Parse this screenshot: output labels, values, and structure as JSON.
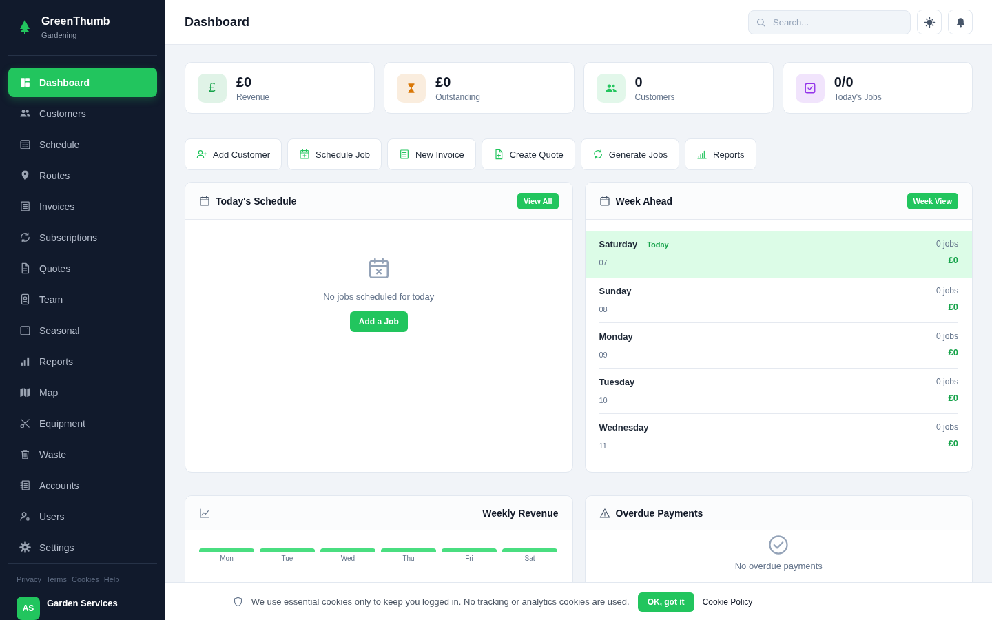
{
  "brand": {
    "name": "GreenThumb",
    "subtitle": "Gardening"
  },
  "sidebar": {
    "items": [
      {
        "label": "Dashboard",
        "selected": true
      },
      {
        "label": "Customers",
        "selected": false
      },
      {
        "label": "Schedule",
        "selected": false
      },
      {
        "label": "Routes",
        "selected": false
      },
      {
        "label": "Invoices",
        "selected": false
      },
      {
        "label": "Subscriptions",
        "selected": false
      },
      {
        "label": "Quotes",
        "selected": false
      },
      {
        "label": "Team",
        "selected": false
      },
      {
        "label": "Seasonal",
        "selected": false
      },
      {
        "label": "Reports",
        "selected": false
      },
      {
        "label": "Map",
        "selected": false
      },
      {
        "label": "Equipment",
        "selected": false
      },
      {
        "label": "Waste",
        "selected": false
      },
      {
        "label": "Accounts",
        "selected": false
      },
      {
        "label": "Users",
        "selected": false
      },
      {
        "label": "Settings",
        "selected": false
      }
    ],
    "footer_links": [
      "Privacy",
      "Terms",
      "Cookies",
      "Help"
    ],
    "account": {
      "initials": "AS",
      "name": "Garden Services"
    }
  },
  "header": {
    "title": "Dashboard",
    "search": {
      "placeholder": "Search..."
    }
  },
  "stats": [
    {
      "value": "£0",
      "label": "Revenue",
      "symbol": "£",
      "color": "#16a34a"
    },
    {
      "value": "£0",
      "label": "Outstanding",
      "color": "#d97706"
    },
    {
      "value": "0",
      "label": "Customers",
      "color": "#22c55e"
    },
    {
      "value": "0/0",
      "label": "Today's Jobs",
      "color": "#9333ea"
    }
  ],
  "quick_actions": [
    {
      "label": "Add Customer"
    },
    {
      "label": "Schedule Job"
    },
    {
      "label": "New Invoice"
    },
    {
      "label": "Create Quote"
    },
    {
      "label": "Generate Jobs"
    },
    {
      "label": "Reports"
    }
  ],
  "schedule": {
    "title": "Today's Schedule",
    "button": "View All",
    "empty_text": "No jobs scheduled for today",
    "action": "Add a Job"
  },
  "week": {
    "title": "Week Ahead",
    "button": "Week View",
    "days": [
      {
        "day": "Saturday",
        "badge": "Today",
        "date": "07",
        "jobs": "0 jobs",
        "amount": "£0",
        "highlighted": true
      },
      {
        "day": "Sunday",
        "date": "08",
        "jobs": "0 jobs",
        "amount": "£0",
        "highlighted": false
      },
      {
        "day": "Monday",
        "date": "09",
        "jobs": "0 jobs",
        "amount": "£0",
        "highlighted": false
      },
      {
        "day": "Tuesday",
        "date": "10",
        "jobs": "0 jobs",
        "amount": "£0",
        "highlighted": false
      },
      {
        "day": "Wednesday",
        "date": "11",
        "jobs": "0 jobs",
        "amount": "£0",
        "highlighted": false
      }
    ]
  },
  "weekly_revenue": {
    "title": "Weekly Revenue",
    "days": [
      "Mon",
      "Tue",
      "Wed",
      "Thu",
      "Fri",
      "Sat"
    ]
  },
  "overdue": {
    "title": "Overdue Payments",
    "empty_text": "No overdue payments"
  },
  "cookie_banner": {
    "text": "We use essential cookies only to keep you logged in. No tracking or analytics cookies are used.",
    "button": "OK, got it",
    "link": "Cookie Policy"
  }
}
